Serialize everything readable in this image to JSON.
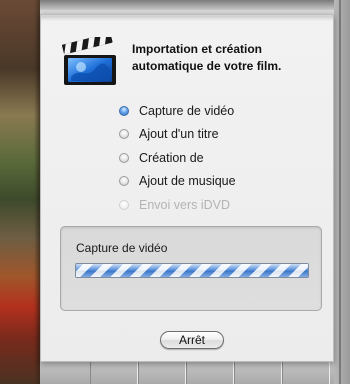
{
  "dialog": {
    "heading": "Importation et création automatique de votre film.",
    "icon": "clapperboard-icon"
  },
  "steps": [
    {
      "label": "Capture de vidéo",
      "state": "active"
    },
    {
      "label": "Ajout d'un titre",
      "state": "pending"
    },
    {
      "label": "Création de",
      "state": "pending"
    },
    {
      "label": "Ajout de musique",
      "state": "pending"
    },
    {
      "label": "Envoi vers iDVD",
      "state": "disabled"
    }
  ],
  "progress": {
    "label": "Capture de vidéo",
    "indeterminate": true
  },
  "buttons": {
    "stop_label": "Arrêt"
  },
  "colors": {
    "accent": "#3f7fd6",
    "disabled_text": "#b4b4b4"
  }
}
